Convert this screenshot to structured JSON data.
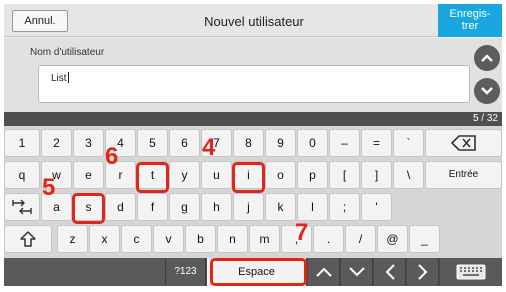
{
  "header": {
    "cancel_label": "Annul.",
    "title": "Nouvel utilisateur",
    "save_label": "Enregis-\ntrer",
    "accent_color": "#1aa7e0"
  },
  "form": {
    "field_label": "Nom d'utilisateur",
    "field_value": "List",
    "scroll_up_icon": "chevron-up-icon",
    "scroll_down_icon": "chevron-down-icon"
  },
  "status": {
    "page_counter": "5 / 32"
  },
  "keyboard": {
    "row1": [
      "1",
      "2",
      "3",
      "4",
      "5",
      "6",
      "7",
      "8",
      "9",
      "0",
      "–",
      "=",
      "`"
    ],
    "row2": [
      "q",
      "w",
      "e",
      "r",
      "t",
      "y",
      "u",
      "i",
      "o",
      "p",
      "[",
      "]",
      "\\"
    ],
    "enter_label": "Entrée",
    "row3": [
      "a",
      "s",
      "d",
      "f",
      "g",
      "h",
      "j",
      "k",
      "l",
      ";",
      "'"
    ],
    "row4": [
      "z",
      "x",
      "c",
      "v",
      "b",
      "n",
      "m",
      ",",
      ".",
      "/",
      "@",
      "_"
    ],
    "mode_label": "?123",
    "space_label": "Espace"
  },
  "annotations": {
    "color": "#e0261a",
    "steps": [
      "4",
      "5",
      "6",
      "7"
    ]
  }
}
